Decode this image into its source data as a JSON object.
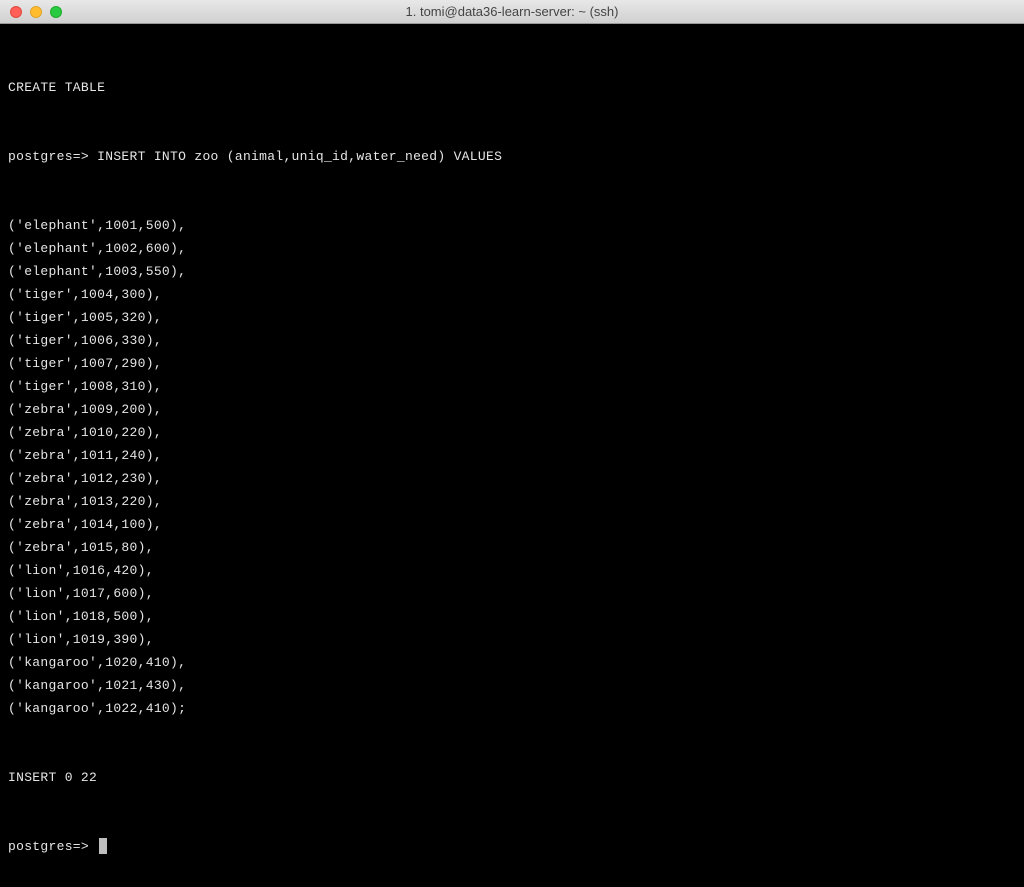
{
  "window": {
    "title": "1. tomi@data36-learn-server: ~ (ssh)"
  },
  "terminal": {
    "line_create": "CREATE TABLE",
    "prompt": "postgres=>",
    "insert_stmt": "INSERT INTO zoo (animal,uniq_id,water_need) VALUES",
    "rows": [
      "('elephant',1001,500),",
      "('elephant',1002,600),",
      "('elephant',1003,550),",
      "('tiger',1004,300),",
      "('tiger',1005,320),",
      "('tiger',1006,330),",
      "('tiger',1007,290),",
      "('tiger',1008,310),",
      "('zebra',1009,200),",
      "('zebra',1010,220),",
      "('zebra',1011,240),",
      "('zebra',1012,230),",
      "('zebra',1013,220),",
      "('zebra',1014,100),",
      "('zebra',1015,80),",
      "('lion',1016,420),",
      "('lion',1017,600),",
      "('lion',1018,500),",
      "('lion',1019,390),",
      "('kangaroo',1020,410),",
      "('kangaroo',1021,430),",
      "('kangaroo',1022,410);"
    ],
    "result": "INSERT 0 22"
  },
  "chart_data": {
    "type": "table",
    "title": "zoo",
    "columns": [
      "animal",
      "uniq_id",
      "water_need"
    ],
    "rows": [
      [
        "elephant",
        1001,
        500
      ],
      [
        "elephant",
        1002,
        600
      ],
      [
        "elephant",
        1003,
        550
      ],
      [
        "tiger",
        1004,
        300
      ],
      [
        "tiger",
        1005,
        320
      ],
      [
        "tiger",
        1006,
        330
      ],
      [
        "tiger",
        1007,
        290
      ],
      [
        "tiger",
        1008,
        310
      ],
      [
        "zebra",
        1009,
        200
      ],
      [
        "zebra",
        1010,
        220
      ],
      [
        "zebra",
        1011,
        240
      ],
      [
        "zebra",
        1012,
        230
      ],
      [
        "zebra",
        1013,
        220
      ],
      [
        "zebra",
        1014,
        100
      ],
      [
        "zebra",
        1015,
        80
      ],
      [
        "lion",
        1016,
        420
      ],
      [
        "lion",
        1017,
        600
      ],
      [
        "lion",
        1018,
        500
      ],
      [
        "lion",
        1019,
        390
      ],
      [
        "kangaroo",
        1020,
        410
      ],
      [
        "kangaroo",
        1021,
        430
      ],
      [
        "kangaroo",
        1022,
        410
      ]
    ]
  }
}
